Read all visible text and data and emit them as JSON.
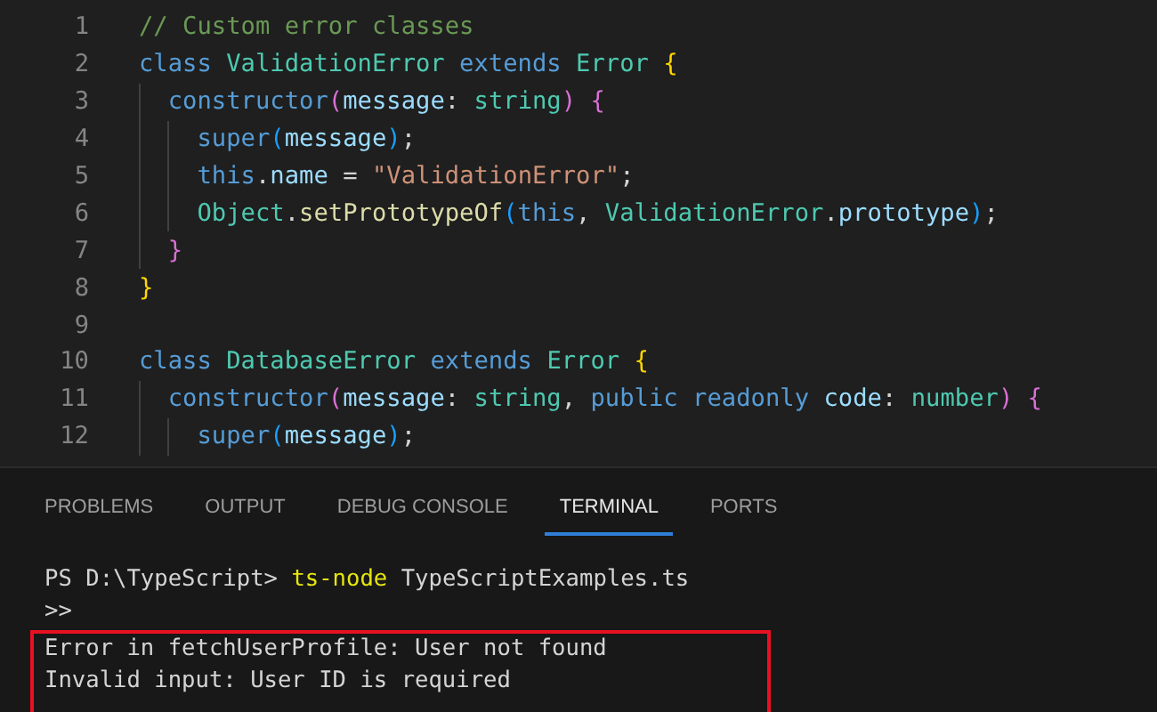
{
  "editor": {
    "lines": [
      {
        "number": "1",
        "tokens": [
          {
            "text": "// Custom error classes",
            "kind": "comment"
          }
        ]
      },
      {
        "number": "2",
        "tokens": [
          {
            "text": "class ",
            "kind": "keyword"
          },
          {
            "text": "ValidationError",
            "kind": "type"
          },
          {
            "text": " extends ",
            "kind": "keyword"
          },
          {
            "text": "Error",
            "kind": "type"
          },
          {
            "text": " {",
            "kind": "brace1"
          }
        ]
      },
      {
        "number": "3",
        "tokens": [
          {
            "text": "  constructor",
            "kind": "keyword"
          },
          {
            "text": "(",
            "kind": "brace2"
          },
          {
            "text": "message",
            "kind": "variable"
          },
          {
            "text": ": ",
            "kind": "plain"
          },
          {
            "text": "string",
            "kind": "type"
          },
          {
            "text": ") {",
            "kind": "brace2"
          }
        ]
      },
      {
        "number": "4",
        "tokens": [
          {
            "text": "    super",
            "kind": "keyword"
          },
          {
            "text": "(",
            "kind": "brace3"
          },
          {
            "text": "message",
            "kind": "variable"
          },
          {
            "text": ")",
            "kind": "brace3"
          },
          {
            "text": ";",
            "kind": "plain"
          }
        ]
      },
      {
        "number": "5",
        "tokens": [
          {
            "text": "    this",
            "kind": "keyword"
          },
          {
            "text": ".",
            "kind": "plain"
          },
          {
            "text": "name",
            "kind": "variable"
          },
          {
            "text": " = ",
            "kind": "plain"
          },
          {
            "text": "\"ValidationError\"",
            "kind": "string"
          },
          {
            "text": ";",
            "kind": "plain"
          }
        ]
      },
      {
        "number": "6",
        "tokens": [
          {
            "text": "    Object",
            "kind": "type"
          },
          {
            "text": ".",
            "kind": "plain"
          },
          {
            "text": "setPrototypeOf",
            "kind": "function"
          },
          {
            "text": "(",
            "kind": "brace3"
          },
          {
            "text": "this",
            "kind": "keyword"
          },
          {
            "text": ", ",
            "kind": "plain"
          },
          {
            "text": "ValidationError",
            "kind": "type"
          },
          {
            "text": ".",
            "kind": "plain"
          },
          {
            "text": "prototype",
            "kind": "variable"
          },
          {
            "text": ")",
            "kind": "brace3"
          },
          {
            "text": ";",
            "kind": "plain"
          }
        ]
      },
      {
        "number": "7",
        "tokens": [
          {
            "text": "  }",
            "kind": "brace2"
          }
        ]
      },
      {
        "number": "8",
        "tokens": [
          {
            "text": "}",
            "kind": "brace1"
          }
        ]
      },
      {
        "number": "9"
      },
      {
        "number": "10",
        "tokens": [
          {
            "text": "class ",
            "kind": "keyword"
          },
          {
            "text": "DatabaseError",
            "kind": "type"
          },
          {
            "text": " extends ",
            "kind": "keyword"
          },
          {
            "text": "Error",
            "kind": "type"
          },
          {
            "text": " {",
            "kind": "brace1"
          }
        ]
      },
      {
        "number": "11",
        "tokens": [
          {
            "text": "  constructor",
            "kind": "keyword"
          },
          {
            "text": "(",
            "kind": "brace2"
          },
          {
            "text": "message",
            "kind": "variable"
          },
          {
            "text": ": ",
            "kind": "plain"
          },
          {
            "text": "string",
            "kind": "type"
          },
          {
            "text": ", ",
            "kind": "plain"
          },
          {
            "text": "public readonly ",
            "kind": "keyword"
          },
          {
            "text": "code",
            "kind": "variable"
          },
          {
            "text": ": ",
            "kind": "plain"
          },
          {
            "text": "number",
            "kind": "type"
          },
          {
            "text": ") {",
            "kind": "brace2"
          }
        ]
      },
      {
        "number": "12",
        "tokens": [
          {
            "text": "    super",
            "kind": "keyword"
          },
          {
            "text": "(",
            "kind": "brace3"
          },
          {
            "text": "message",
            "kind": "variable"
          },
          {
            "text": ")",
            "kind": "brace3"
          },
          {
            "text": ";",
            "kind": "plain"
          }
        ]
      }
    ]
  },
  "panel": {
    "tabs": [
      {
        "label": "PROBLEMS",
        "selected": false
      },
      {
        "label": "OUTPUT",
        "selected": false
      },
      {
        "label": "DEBUG CONSOLE",
        "selected": false
      },
      {
        "label": "TERMINAL",
        "selected": true
      },
      {
        "label": "PORTS",
        "selected": false
      }
    ],
    "terminal": [
      {
        "tokens": [
          {
            "text": "PS D:\\TypeScript> ",
            "kind": "plain"
          },
          {
            "text": "ts-node",
            "kind": "command"
          },
          {
            "text": " TypeScriptExamples.ts",
            "kind": "plain"
          }
        ],
        "highlighted": false
      },
      {
        "tokens": [
          {
            "text": ">>",
            "kind": "plain"
          }
        ],
        "highlighted": false
      },
      {
        "tokens": [
          {
            "text": "Error in fetchUserProfile: User not found",
            "kind": "plain"
          }
        ],
        "highlighted": true
      },
      {
        "tokens": [
          {
            "text": "Invalid input: User ID is required",
            "kind": "plain"
          }
        ],
        "highlighted": true
      }
    ]
  }
}
